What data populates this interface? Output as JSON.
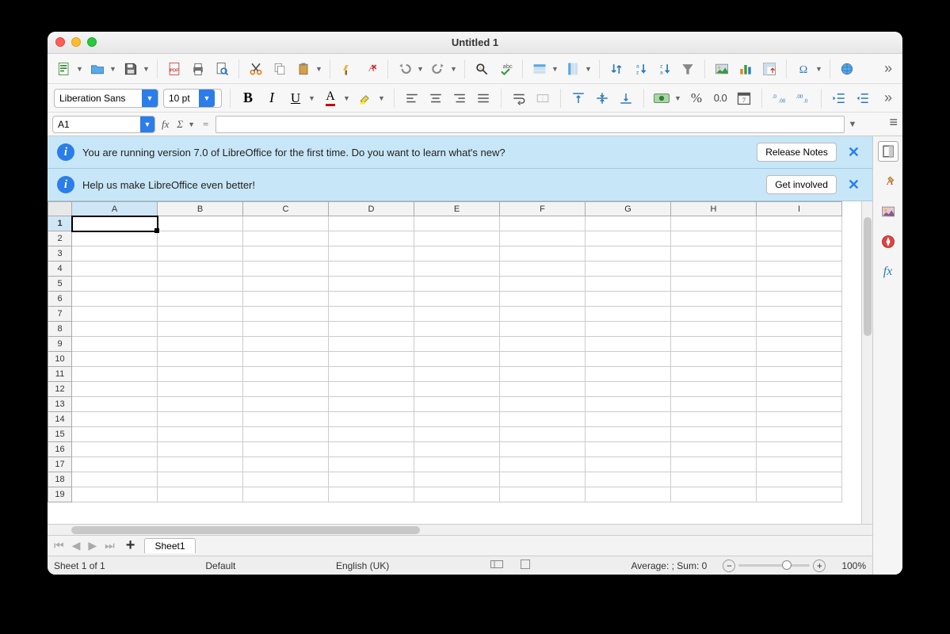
{
  "window": {
    "title": "Untitled 1"
  },
  "toolbar1_icons": [
    "new",
    "open",
    "save",
    "sep",
    "pdf",
    "print",
    "preview",
    "sep",
    "cut",
    "copy",
    "paste",
    "sep",
    "brush",
    "clear-format",
    "sep",
    "undo",
    "redo",
    "sep",
    "find",
    "spellcheck",
    "sep",
    "row-ops",
    "col-ops",
    "sep",
    "sort",
    "sort-asc",
    "sort-desc",
    "filter",
    "sep",
    "image",
    "chart",
    "pivot",
    "sep",
    "special-char",
    "sep",
    "hyperlink"
  ],
  "format": {
    "font_name": "Liberation Sans",
    "font_size": "10 pt",
    "buttons": [
      "bold",
      "italic",
      "underline",
      "font-color",
      "highlight",
      "sep",
      "align-left",
      "align-center",
      "align-right",
      "justify",
      "sep",
      "wrap",
      "merge",
      "sep",
      "valign-top",
      "valign-mid",
      "valign-bot",
      "sep",
      "currency",
      "percent",
      "number",
      "date",
      "sep",
      "add-decimal",
      "remove-decimal",
      "sep",
      "indent-inc",
      "indent-dec"
    ]
  },
  "cellref": {
    "value": "A1"
  },
  "notices": [
    {
      "text": "You are running version 7.0 of LibreOffice for the first time. Do you want to learn what's new?",
      "button": "Release Notes"
    },
    {
      "text": "Help us make LibreOffice even better!",
      "button": "Get involved"
    }
  ],
  "sidebar_icons": [
    "menu",
    "properties",
    "styles",
    "gallery",
    "navigator",
    "functions"
  ],
  "columns": [
    "A",
    "B",
    "C",
    "D",
    "E",
    "F",
    "G",
    "H",
    "I"
  ],
  "rows": [
    1,
    2,
    3,
    4,
    5,
    6,
    7,
    8,
    9,
    10,
    11,
    12,
    13,
    14,
    15,
    16,
    17,
    18,
    19
  ],
  "selected_cell": {
    "col": "A",
    "row": 1
  },
  "sheet_tabs": {
    "active": "Sheet1"
  },
  "status": {
    "sheet_info": "Sheet 1 of 1",
    "style": "Default",
    "language": "English (UK)",
    "summary": "Average: ; Sum: 0",
    "zoom": "100%"
  }
}
